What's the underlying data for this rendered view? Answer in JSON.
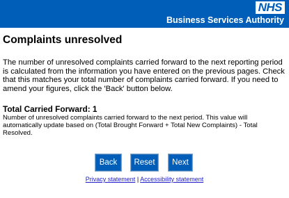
{
  "header": {
    "logo": "NHS",
    "org_name": "Business Services Authority",
    "colors": {
      "background": "#005eb8",
      "logo_text": "#005eb8"
    }
  },
  "main": {
    "title": "Complaints unresolved",
    "intro": "The number of unresolved complaints carried forward to the next reporting period is calculated from the information you have entered on the previous pages. Check that this matches your total number of complaints carried forward. If you need to amend your figures, click the 'Back' button below.",
    "total_heading": "Total Carried Forward: 1",
    "total_description": "Number of unresolved complaints carried forward to the next period. This value will automatically update based on (Total Brought Forward + Total New Complaints) - Total Resolved."
  },
  "buttons": {
    "back": "Back",
    "reset": "Reset",
    "next": "Next",
    "color": "#005eb8"
  },
  "footer": {
    "privacy": "Privacy statement",
    "separator": "|",
    "accessibility": "Accessibility statement",
    "link_color": "#1d1dcc"
  }
}
